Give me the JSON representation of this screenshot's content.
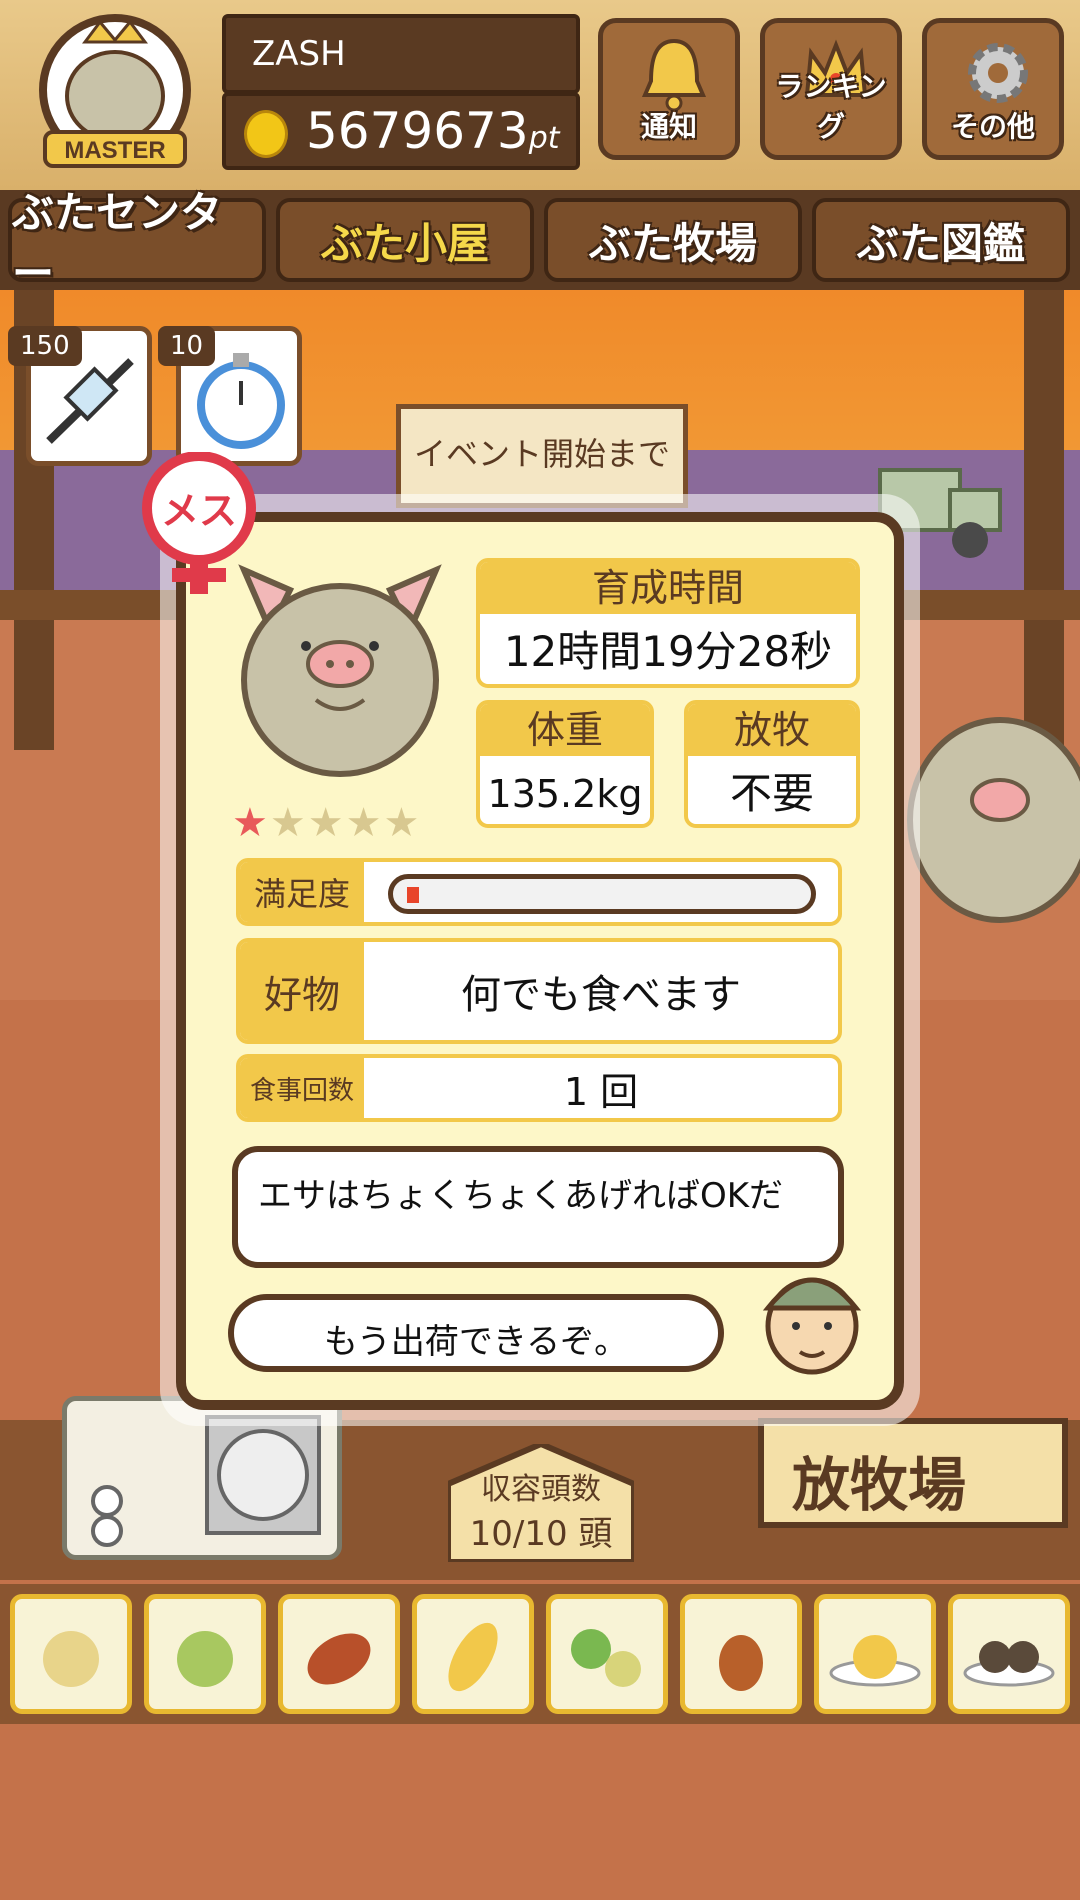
{
  "header": {
    "badge_text": "MASTER",
    "player_name": "ZASH",
    "points_value": "5679673",
    "points_unit": "pt",
    "buttons": [
      {
        "label": "通知",
        "icon": "bell-icon"
      },
      {
        "label": "ランキング",
        "icon": "crown-icon"
      },
      {
        "label": "その他",
        "icon": "gear-icon"
      }
    ]
  },
  "tabs": [
    {
      "label": "ぶたセンター",
      "active": false
    },
    {
      "label": "ぶた小屋",
      "active": true
    },
    {
      "label": "ぶた牧場",
      "active": false
    },
    {
      "label": "ぶた図鑑",
      "active": false
    }
  ],
  "items": [
    {
      "count": "150",
      "icon": "syringe-icon"
    },
    {
      "count": "10",
      "icon": "stopwatch-icon"
    }
  ],
  "event_sign": {
    "line1": "イベント開始まで"
  },
  "pig_detail": {
    "gender_label": "メス",
    "rating": {
      "filled": 1,
      "total": 5
    },
    "growth_time_label": "育成時間",
    "growth_time_value": "12時間19分28秒",
    "weight_label": "体重",
    "weight_value": "135.2kg",
    "grazing_label": "放牧",
    "grazing_value": "不要",
    "satisfaction_label": "満足度",
    "satisfaction_level": 0.03,
    "favorite_label": "好物",
    "favorite_value": "何でも食べます",
    "meals_label": "食事回数",
    "meals_value": "1 回",
    "message1": "エサはちょくちょくあげればOKだ",
    "message2": "もう出荷できるぞ。"
  },
  "capacity_sign": {
    "label": "収容頭数",
    "value": "10/10 頭"
  },
  "pasture_sign": "放牧場",
  "food_items": [
    "grain-pile-icon",
    "mixed-grain-icon",
    "sweet-potato-icon",
    "corn-icon",
    "vegetables-icon",
    "acorn-icon",
    "grain-plate-icon",
    "truffle-plate-icon"
  ],
  "colors": {
    "wood_dark": "#5a3a22",
    "panel_yellow": "#f2c84a",
    "panel_bg": "#fdf7c8",
    "accent_red": "#e8452a"
  }
}
